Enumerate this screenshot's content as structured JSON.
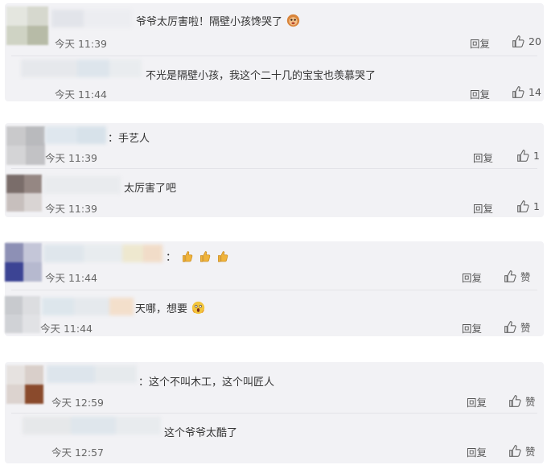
{
  "like_word": "赞",
  "reply_word": "回复",
  "threads": [
    {
      "comments": [
        {
          "text": "爷爷太厉害啦！隔壁小孩馋哭了",
          "time": "今天 11:39",
          "likes": "20",
          "emoji": "monkey-face-emoji"
        },
        {
          "text": "不光是隔壁小孩，我这个二十几的宝宝也羡慕哭了",
          "time": "今天 11:44",
          "likes": "14"
        }
      ]
    },
    {
      "comments": [
        {
          "text": "：手艺人",
          "time": "今天 11:39",
          "likes": "1"
        },
        {
          "text": "太厉害了吧",
          "time": "今天 11:39",
          "likes": "1"
        }
      ]
    },
    {
      "comments": [
        {
          "text": "：",
          "time": "今天 11:44",
          "likes": "赞",
          "emoji": "thumbs-up-emoji"
        },
        {
          "text": "天哪，想要",
          "time": "今天 11:44",
          "likes": "赞",
          "emoji": "screaming-face-emoji"
        }
      ]
    },
    {
      "comments": [
        {
          "text": "：这个不叫木工，这个叫匠人",
          "time": "今天 12:59",
          "likes": "赞"
        },
        {
          "text": "这个爷爷太酷了",
          "time": "今天 12:57",
          "likes": "赞"
        }
      ]
    }
  ]
}
